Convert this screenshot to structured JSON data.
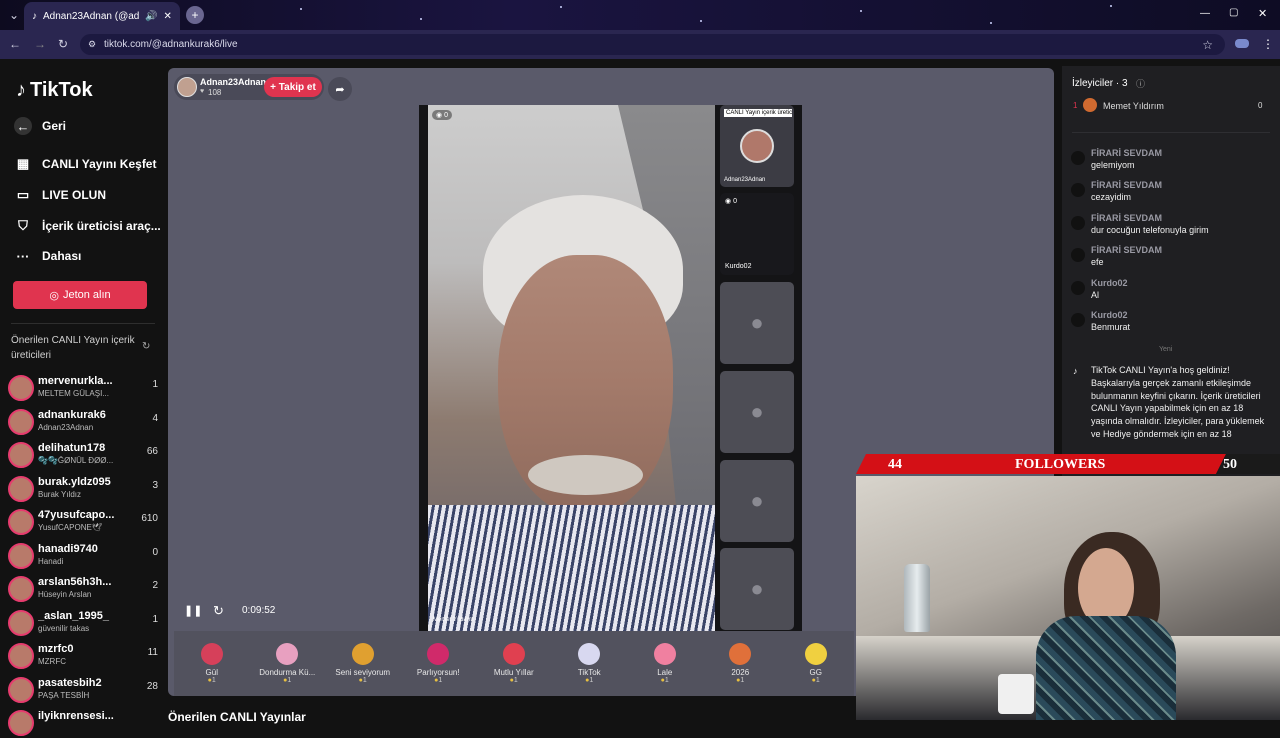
{
  "browser": {
    "tab_title": "Adnan23Adnan (@adnankurak6)",
    "url": "tiktok.com/@adnankurak6/live"
  },
  "sidebar": {
    "logo": "TikTok",
    "items": [
      {
        "label": "Geri",
        "icon": "back-icon"
      },
      {
        "label": "CANLI Yayını Keşfet",
        "icon": "calendar-icon"
      },
      {
        "label": "LIVE OLUN",
        "icon": "camera-icon"
      },
      {
        "label": "İçerik üreticisi araç...",
        "icon": "shield-icon"
      },
      {
        "label": "Dahası",
        "icon": "more-icon"
      }
    ],
    "coin_button": "Jeton alın",
    "suggest_title": "Önerilen CANLI Yayın içerik üreticileri",
    "creators": [
      {
        "name": "mervenurkla...",
        "sub": "MELTEM GÜLAŞI...",
        "count": "1"
      },
      {
        "name": "adnankurak6",
        "sub": "Adnan23Adnan",
        "count": "4"
      },
      {
        "name": "delihatun178",
        "sub": "🫧🫧ĞØNÜL ĐØØ...",
        "count": "66"
      },
      {
        "name": "burak.yldz095",
        "sub": "Burak Yıldız",
        "count": "3"
      },
      {
        "name": "47yusufcapo...",
        "sub": "YusufCAPONE🕊",
        "count": "610"
      },
      {
        "name": "hanadi9740",
        "sub": "Hanadi",
        "count": "0"
      },
      {
        "name": "arslan56h3h...",
        "sub": "Hüseyin Arslan",
        "count": "2"
      },
      {
        "name": "_aslan_1995_",
        "sub": "güvenilir takas",
        "count": "1"
      },
      {
        "name": "mzrfc0",
        "sub": "MZRFC",
        "count": "11"
      },
      {
        "name": "pasatesbih2",
        "sub": "PAŞA TESBİH",
        "count": "28"
      },
      {
        "name": "ilyiknrensesi...",
        "sub": "",
        "count": ""
      }
    ]
  },
  "live": {
    "host": "Adnan23Adnan",
    "likes": "108",
    "follow": "+ Takip et",
    "viewers_badge": "0",
    "main_name": "Memet Yıldırım",
    "guest1": "Adnan23Adnan",
    "guest1_banner": "CANLI Yayın içerik üretic",
    "guest2": "Kurdo02",
    "guest2_badge": "0",
    "time": "0:09:52"
  },
  "gifts": [
    {
      "name": "Gül",
      "price": "1",
      "color": "#d6405a"
    },
    {
      "name": "Dondurma Kü...",
      "price": "1",
      "color": "#e8a0c0"
    },
    {
      "name": "Seni seviyorum",
      "price": "1",
      "color": "#e0a030"
    },
    {
      "name": "Parlıyorsun!",
      "price": "1",
      "color": "#d02a6a"
    },
    {
      "name": "Mutlu Yıllar",
      "price": "1",
      "color": "#e04050"
    },
    {
      "name": "TikTok",
      "price": "1",
      "color": "#d8d8f0"
    },
    {
      "name": "Lale",
      "price": "1",
      "color": "#f080a0"
    },
    {
      "name": "2026",
      "price": "1",
      "color": "#e0703a"
    },
    {
      "name": "GG",
      "price": "1",
      "color": "#f0d040"
    }
  ],
  "chat": {
    "title": "İzleyiciler · 3",
    "top_rank": "1",
    "top_name": "Memet Yıldırım",
    "top_count": "0",
    "messages": [
      {
        "who": "FİRARİ SEVDAM",
        "text": "gelemiyom"
      },
      {
        "who": "FİRARİ SEVDAM",
        "text": "cezayidim"
      },
      {
        "who": "FİRARİ SEVDAM",
        "text": "dur cocuğun telefonuyla girim"
      },
      {
        "who": "FİRARİ SEVDAM",
        "text": "efe"
      },
      {
        "who": "Kurdo02",
        "text": "Al"
      },
      {
        "who": "Kurdo02",
        "text": "Benmurat"
      }
    ],
    "new_label": "Yeni",
    "welcome": "TikTok CANLI Yayın'a hoş geldiniz! Başkalarıyla gerçek zamanlı etkileşimde bulunmanın keyfini çıkarın. İçerik üreticileri CANLI Yayın yapabilmek için en az 18 yaşında olmalıdır. İzleyiciler, para yüklemek ve Hediye göndermek için en az 18"
  },
  "overlay": {
    "left": "44",
    "label": "FOLLOWERS",
    "right": "50"
  },
  "footer": "Önerilen CANLI Yayınlar"
}
